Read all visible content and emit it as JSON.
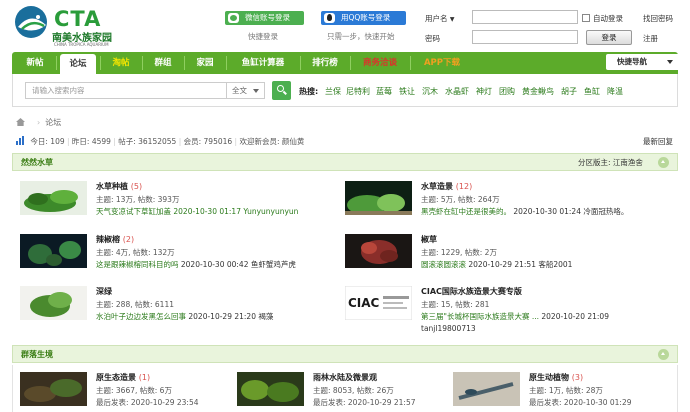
{
  "logo": {
    "mark": "CTA",
    "name_cn": "南美水族家园",
    "name_en": "CHINA TROPICA AQUARIUM"
  },
  "quick_login": {
    "wechat_label": "微信账号登录",
    "wechat_sub": "快捷登录",
    "qq_label": "用QQ账号登录",
    "qq_sub": "只需一步，快速开始"
  },
  "login": {
    "username_label": "用户名",
    "password_label": "密码",
    "auto_login": "自动登录",
    "login_button": "登录",
    "forgot": "找回密码",
    "register": "注册"
  },
  "nav": {
    "items": [
      "新帖",
      "论坛",
      "淘帖",
      "群组",
      "家园",
      "鱼缸计算器",
      "排行榜",
      "商务洽谈",
      "APP下载"
    ],
    "right": "快捷导航"
  },
  "search": {
    "placeholder": "请输入搜索内容",
    "scope": "全文",
    "hot_label": "热搜:",
    "hot": [
      "兰保",
      "尼特利",
      "蓝莓",
      "铁让",
      "沉木",
      "水晶虾",
      "神灯",
      "团购",
      "黄金鳅鸟",
      "胡子",
      "鱼缸",
      "降温"
    ]
  },
  "breadcrumb": "论坛",
  "stats": {
    "today": "今日: 109",
    "yesterday": "昨日: 4599",
    "posts": "帖子: 36152055",
    "members": "会员: 795016",
    "newest": "欢迎新会员: 颜仙黄",
    "latest": "最新回复"
  },
  "sections": [
    {
      "title": "然然水草",
      "moderator": "分区版主: 江南渔舍",
      "forums": [
        {
          "name": "水草种植",
          "count": "(5)",
          "stat": "主题: 13万, 帖数: 393万",
          "last": "天气变凉试下草缸加盖 2020-10-30 01:17 Yunyunyunyun"
        },
        {
          "name": "水草造景",
          "count": "(12)",
          "stat": "主题: 5万, 帖数: 264万",
          "last_title": "黑壳虾在缸中还是很美的。",
          "last_meta": "2020-10-30 01:24 冷面冠热咯。"
        },
        {
          "name": "辣椒榕",
          "count": "(2)",
          "stat": "主题: 4万, 帖数: 132万",
          "last_title": "这是跟辣椒榕同科目的吗",
          "last_meta": "2020-10-30 00:42 鱼虾蟹鸡芦虎"
        },
        {
          "name": "椒草",
          "count": "",
          "stat": "主题: 1229, 帖数: 2万",
          "last_title": "圆滚滚圆滚滚",
          "last_meta": "2020-10-29 21:51 客船2001"
        },
        {
          "name": "深绿",
          "count": "",
          "stat": "主题: 288, 帖数: 6111",
          "last_title": "水泊叶子边边发黑怎么回事",
          "last_meta": "2020-10-29 21:20 褐藻"
        },
        {
          "name": "CIAC国际水族造景大赛专版",
          "count": "",
          "stat": "主题: 15, 帖数: 281",
          "last_title": "第三届\"长城杯国际水族造景大赛 ...",
          "last_meta": "2020-10-20 21:09",
          "last_user": "tanjl19800713"
        }
      ]
    },
    {
      "title": "群落生境",
      "forums": [
        {
          "name": "原生态造景",
          "count": "(1)",
          "stat": "主题: 3667, 帖数: 6万",
          "last": "最后发表: 2020-10-29 23:54"
        },
        {
          "name": "雨林水陆及微景观",
          "count": "",
          "stat": "主题: 8053, 帖数: 26万",
          "last": "最后发表: 2020-10-29 21:57"
        },
        {
          "name": "原生动植物",
          "count": "(3)",
          "stat": "主题: 1万, 帖数: 28万",
          "last": "最后发表: 2020-10-30 01:29"
        }
      ]
    }
  ],
  "colors": {
    "brand_green": "#5cab2a",
    "link_green": "#2a7a1a",
    "accent_red": "#d9534f",
    "orange": "#f0a020"
  }
}
